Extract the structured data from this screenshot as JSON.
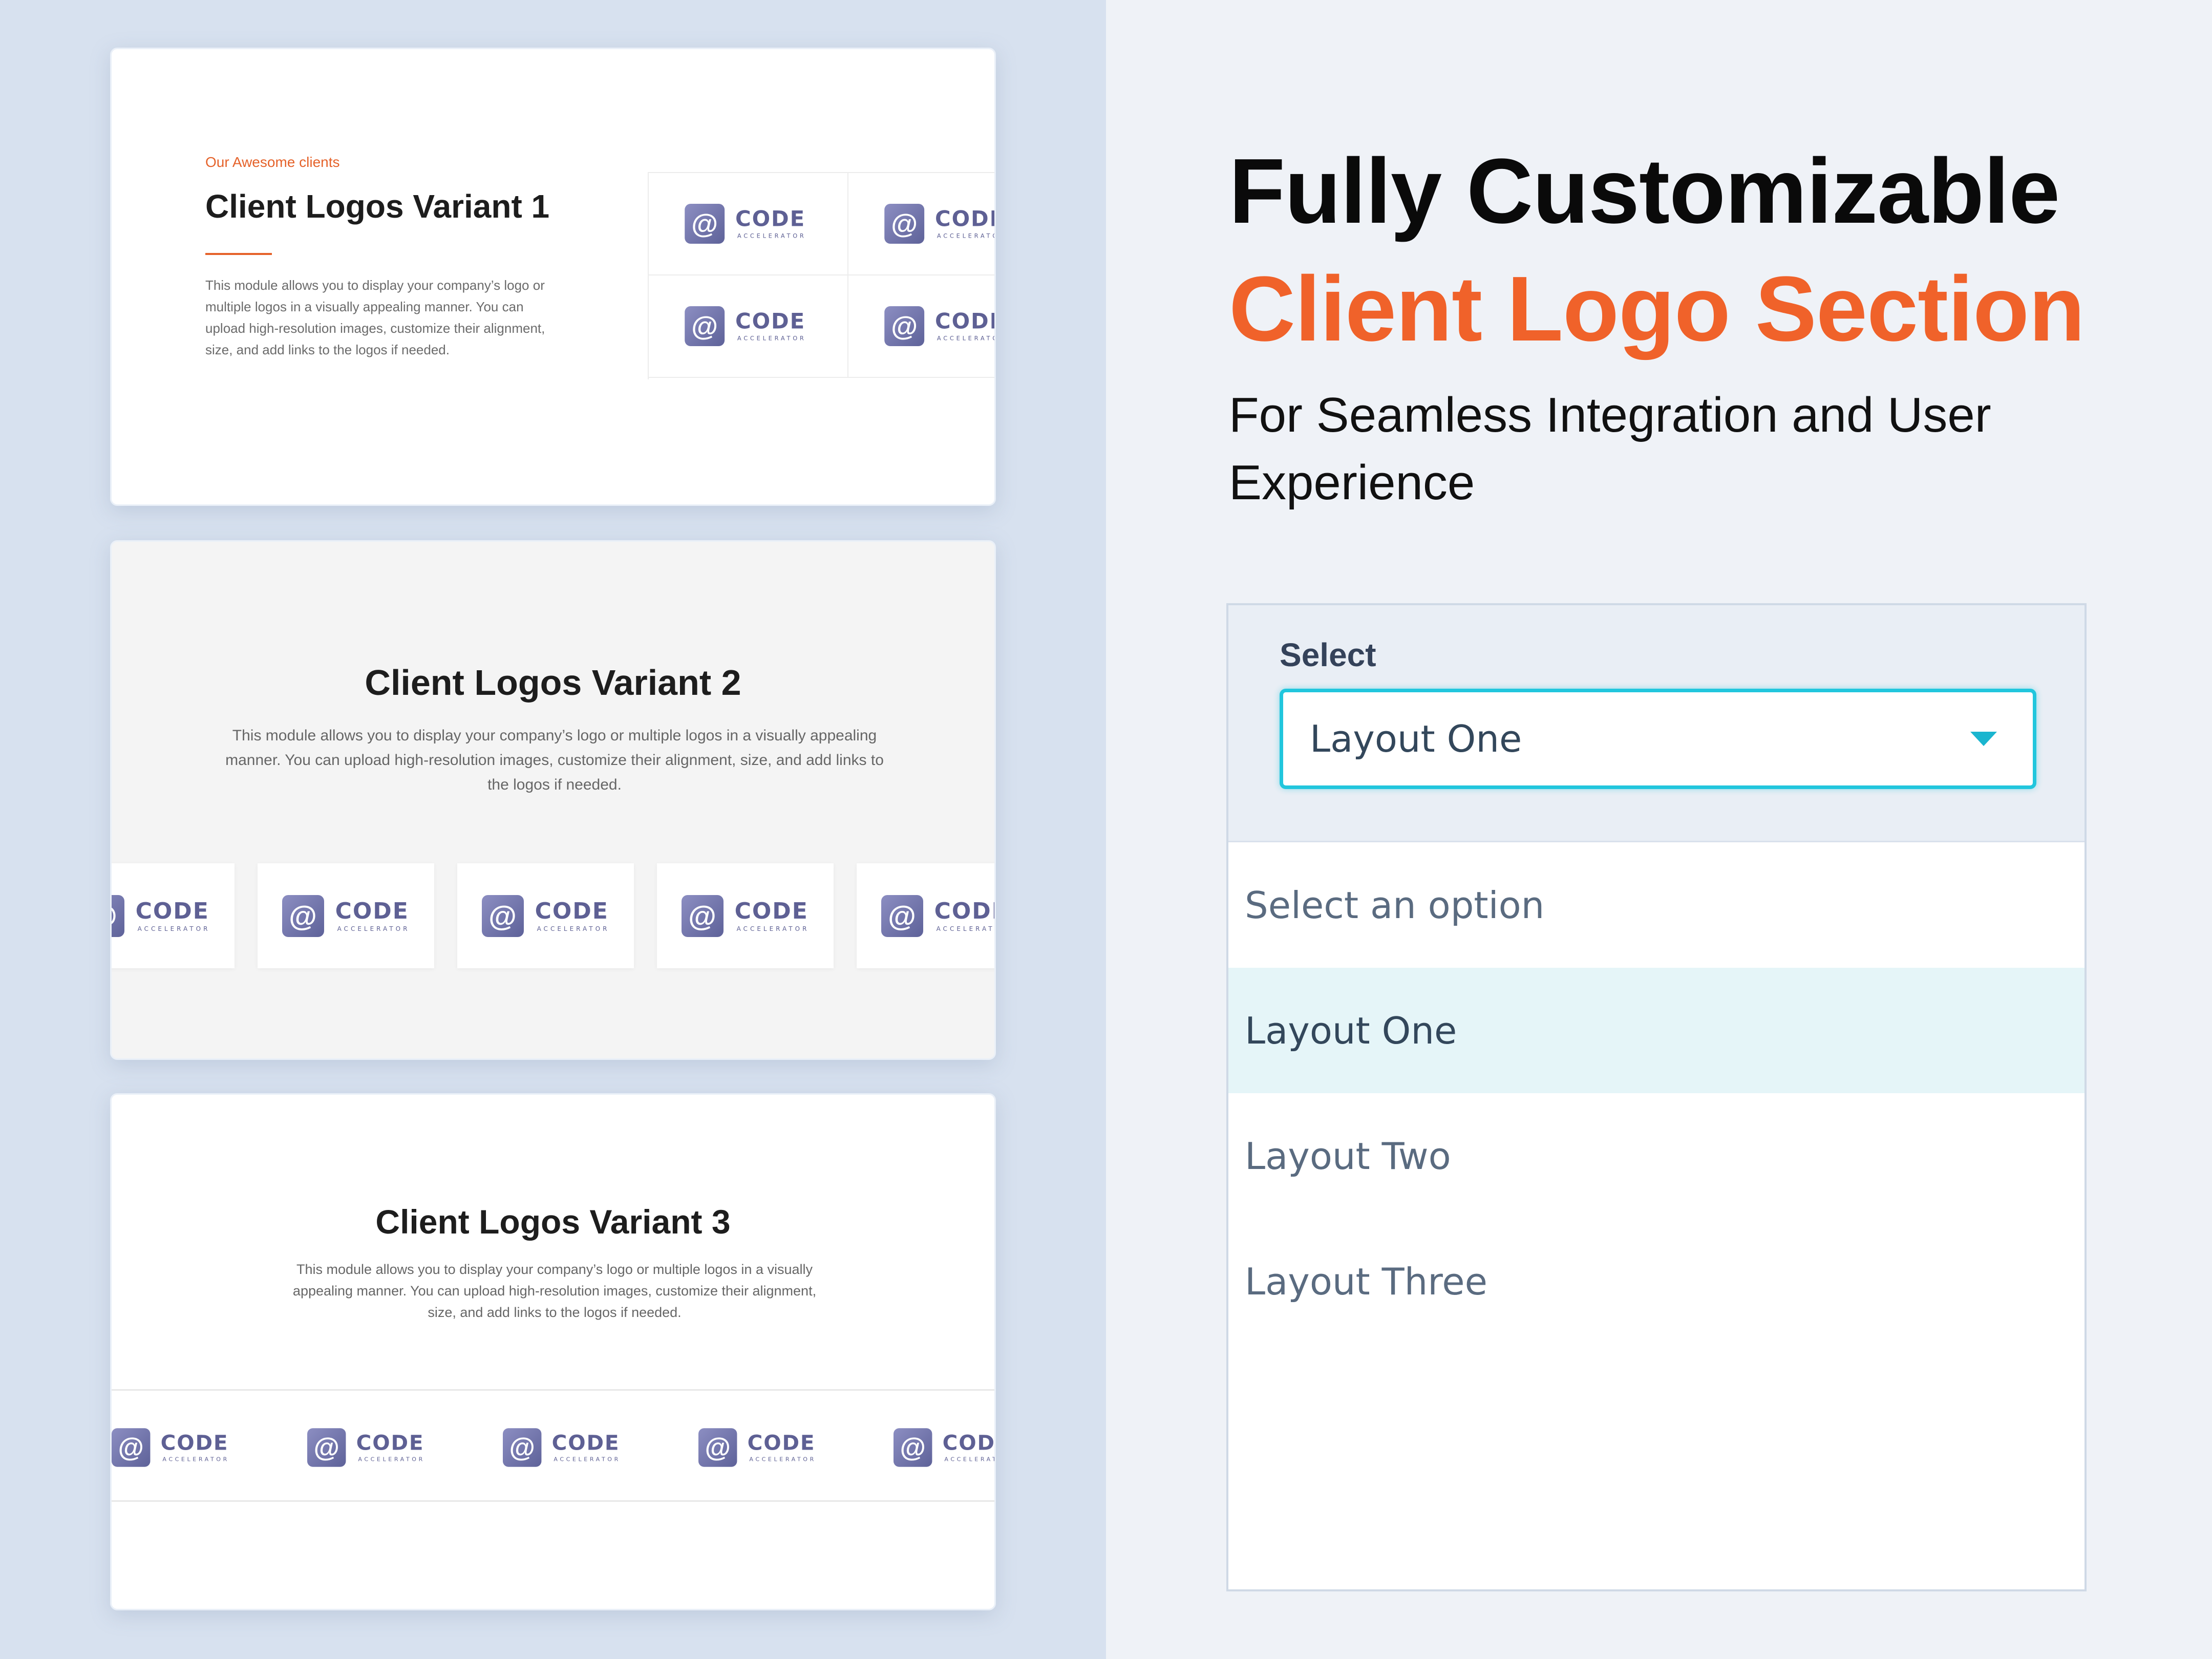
{
  "card1": {
    "eyebrow": "Our Awesome clients",
    "title": "Client Logos Variant 1",
    "description": "This module allows you to display your company’s logo or multiple logos in a visually appealing manner. You can upload high-resolution images, customize their alignment, size, and add links to the logos if needed."
  },
  "card2": {
    "title": "Client Logos Variant 2",
    "description": "This module allows you to display your company’s logo or multiple logos in a visually appealing manner. You can upload high-resolution images, customize their alignment, size, and add links to the logos if needed."
  },
  "card3": {
    "title": "Client Logos Variant 3",
    "description": "This module allows you to display your company’s logo or multiple logos in a visually appealing manner. You can upload high-resolution images, customize their alignment, size, and add links to the logos if needed."
  },
  "logo": {
    "mark": "@",
    "word": "CODE",
    "sub": "ACCELERATOR"
  },
  "headline": {
    "line1": "Fully Customizable",
    "line2": "Client Logo Section",
    "sub": "For Seamless Integration and User Experience"
  },
  "select": {
    "label": "Select",
    "value": "Layout One",
    "options": [
      "Select an option",
      "Layout One",
      "Layout Two",
      "Layout Three"
    ],
    "selected_index": 1
  },
  "colors": {
    "accent_orange": "#f0622a",
    "focus_cyan": "#21c6dd",
    "logo_purple": "#5e6094"
  },
  "icons": {
    "dropdown": "caret-down-icon",
    "logo": "code-accelerator-logo"
  }
}
